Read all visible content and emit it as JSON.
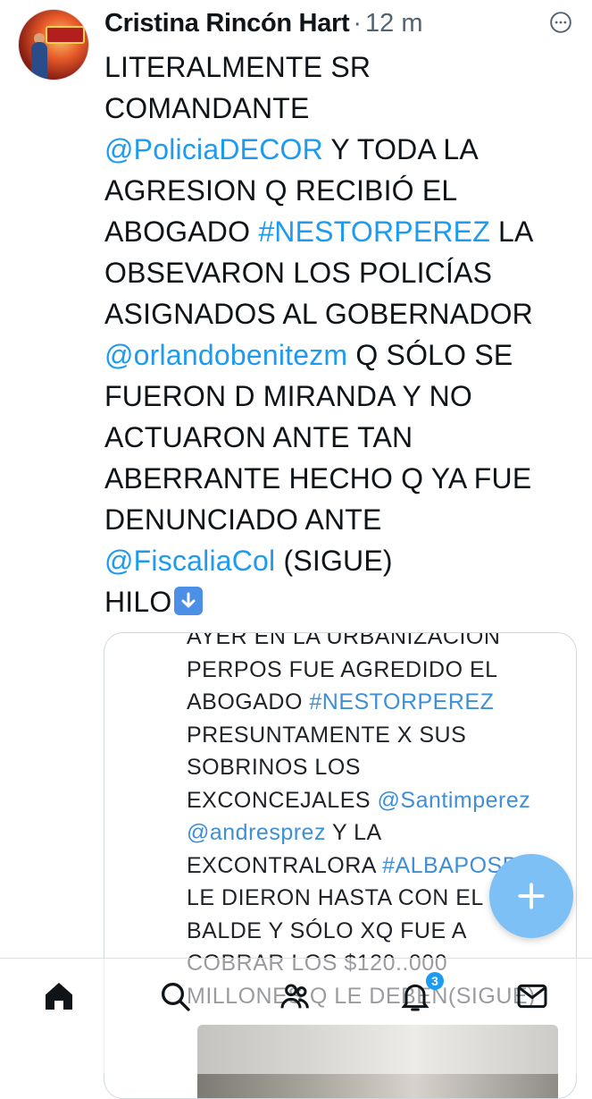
{
  "tweet": {
    "author_name": "Cristina Rincón Hart",
    "separator": "·",
    "time": "12 m",
    "lines": [
      [
        {
          "t": "LITERALMENTE SR",
          "link": false
        }
      ],
      [
        {
          "t": "COMANDANTE",
          "link": false
        }
      ],
      [
        {
          "t": "@PoliciaDECOR",
          "link": true
        },
        {
          "t": " Y TODA LA",
          "link": false
        }
      ],
      [
        {
          "t": "AGRESION Q RECIBIÓ EL",
          "link": false
        }
      ],
      [
        {
          "t": "ABOGADO ",
          "link": false
        },
        {
          "t": "#NESTORPEREZ",
          "link": true
        },
        {
          "t": " LA",
          "link": false
        }
      ],
      [
        {
          "t": "OBSEVARON LOS POLICÍAS",
          "link": false
        }
      ],
      [
        {
          "t": "ASIGNADOS AL GOBERNADOR",
          "link": false
        }
      ],
      [
        {
          "t": "@orlandobenitezm",
          "link": true
        },
        {
          "t": " Q SÓLO SE",
          "link": false
        }
      ],
      [
        {
          "t": "FUERON D MIRANDA Y NO",
          "link": false
        }
      ],
      [
        {
          "t": "ACTUARON ANTE TAN",
          "link": false
        }
      ],
      [
        {
          "t": "ABERRANTE HECHO Q YA FUE",
          "link": false
        }
      ],
      [
        {
          "t": "DENUNCIADO ANTE",
          "link": false
        }
      ],
      [
        {
          "t": "@FiscaliaCol",
          "link": true
        },
        {
          "t": " (SIGUE)",
          "link": false
        }
      ],
      [
        {
          "t": "HILO",
          "link": false
        }
      ]
    ],
    "emoji": "down-arrow-emoji"
  },
  "media": {
    "lines": [
      [
        {
          "t": "AYER EN LA URBANIZACIÓN",
          "link": false
        }
      ],
      [
        {
          "t": "PERPOS FUE AGREDIDO EL",
          "link": false
        }
      ],
      [
        {
          "t": "ABOGADO ",
          "link": false
        },
        {
          "t": "#NESTORPEREZ",
          "link": true
        }
      ],
      [
        {
          "t": "PRESUNTAMENTE X SUS",
          "link": false
        }
      ],
      [
        {
          "t": "SOBRINOS LOS",
          "link": false
        }
      ],
      [
        {
          "t": "EXCONCEJALES ",
          "link": false
        },
        {
          "t": "@Santimperez",
          "link": true
        }
      ],
      [
        {
          "t": "@andresprez",
          "link": true
        },
        {
          "t": " Y LA",
          "link": false
        }
      ],
      [
        {
          "t": "EXCONTRALORA ",
          "link": false
        },
        {
          "t": "#ALBAPOSDA",
          "link": true
        }
      ],
      [
        {
          "t": "LE DIERON HASTA CON EL",
          "link": false
        }
      ],
      [
        {
          "t": "BALDE Y SÓLO XQ FUE A",
          "link": false
        }
      ],
      [
        {
          "t": "COBRAR LOS $120..000",
          "link": false
        }
      ],
      [
        {
          "t": "MILLONES Q LE DEBEN(SIGUE)",
          "link": false
        }
      ]
    ]
  },
  "tabbar": {
    "items": [
      "home-icon",
      "search-icon",
      "communities-icon",
      "notifications-icon",
      "messages-icon"
    ],
    "notifications_badge": "3"
  },
  "colors": {
    "link": "#1d9bf0",
    "fab": "#7cc0f5",
    "text": "#0f1419",
    "muted": "#536471"
  }
}
